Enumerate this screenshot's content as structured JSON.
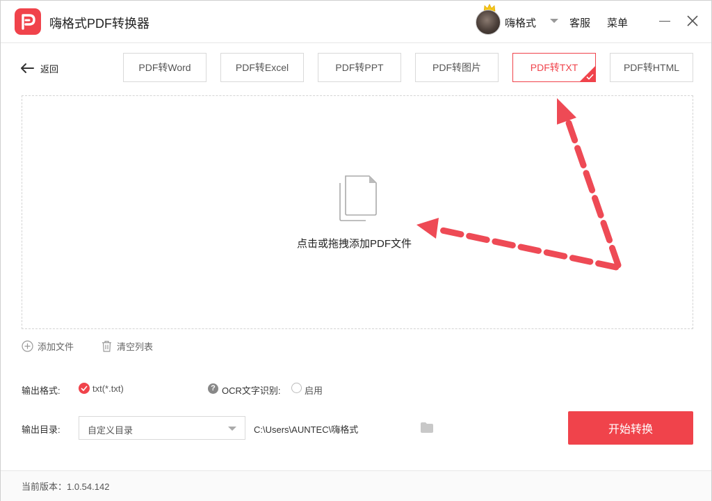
{
  "app": {
    "title": "嗨格式PDF转换器"
  },
  "header": {
    "username": "嗨格式",
    "service_label": "客服",
    "menu_label": "菜单"
  },
  "nav": {
    "back_label": "返回"
  },
  "tabs": [
    {
      "label": "PDF转Word",
      "active": false
    },
    {
      "label": "PDF转Excel",
      "active": false
    },
    {
      "label": "PDF转PPT",
      "active": false
    },
    {
      "label": "PDF转图片",
      "active": false
    },
    {
      "label": "PDF转TXT",
      "active": true
    },
    {
      "label": "PDF转HTML",
      "active": false
    }
  ],
  "dropzone": {
    "prompt": "点击或拖拽添加PDF文件"
  },
  "file_actions": {
    "add_label": "添加文件",
    "clear_label": "清空列表"
  },
  "output": {
    "format_label": "输出格式:",
    "format_value": "txt(*.txt)",
    "ocr_label": "OCR文字识别:",
    "ocr_enable_label": "启用",
    "ocr_enabled": false,
    "dir_label": "输出目录:",
    "dir_select_value": "自定义目录",
    "dir_path": "C:\\Users\\AUNTEC\\嗨格式"
  },
  "actions": {
    "start_label": "开始转换"
  },
  "footer": {
    "version": "当前版本：1.0.54.142"
  },
  "colors": {
    "accent": "#f0434b",
    "annotation_arrow": "#ee4a55"
  }
}
